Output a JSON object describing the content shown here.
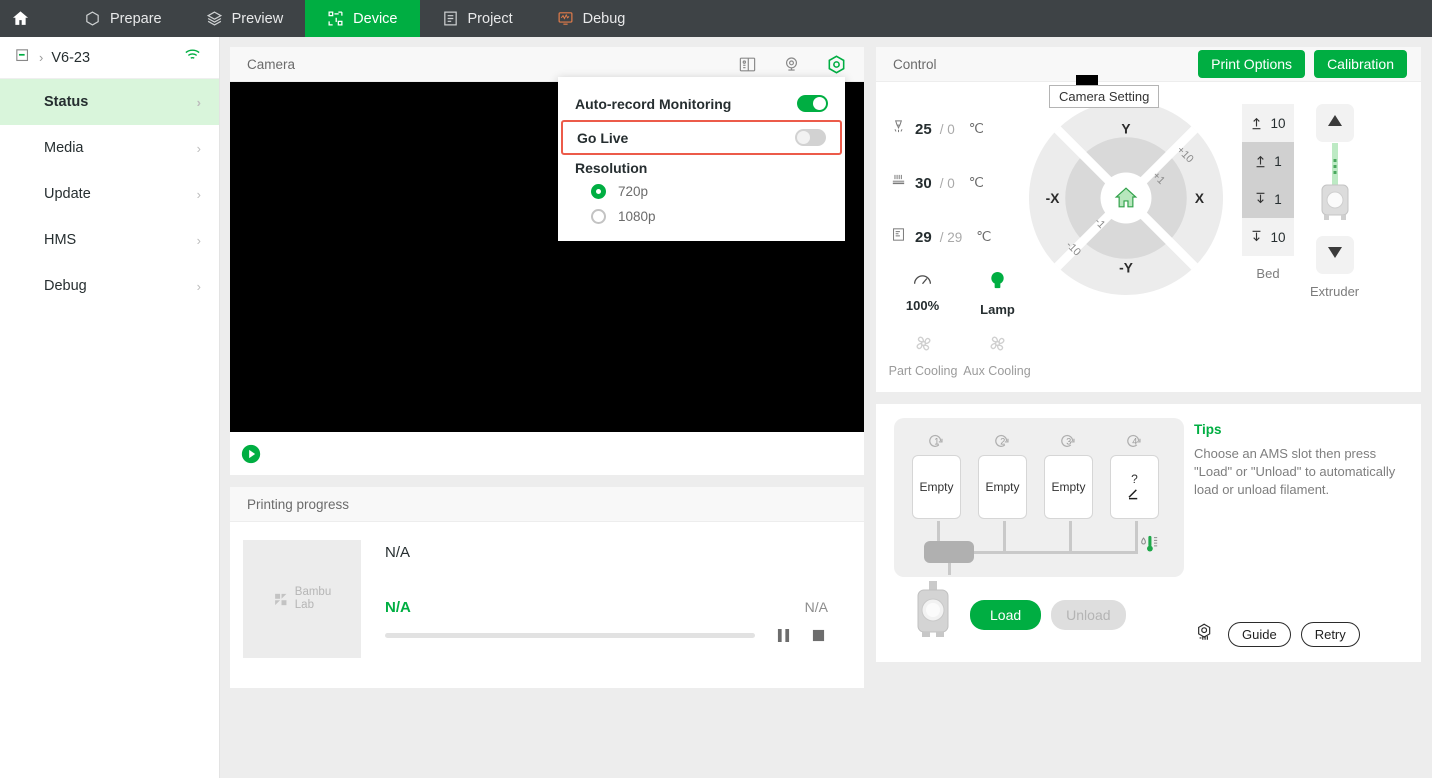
{
  "topnav": {
    "home_icon": "home-icon",
    "items": [
      {
        "label": "Prepare",
        "icon": "cube-outline-icon",
        "active": false
      },
      {
        "label": "Preview",
        "icon": "layers-icon",
        "active": false
      },
      {
        "label": "Device",
        "icon": "device-network-icon",
        "active": true
      },
      {
        "label": "Project",
        "icon": "list-document-icon",
        "active": false
      },
      {
        "label": "Debug",
        "icon": "monitor-wave-icon",
        "active": false
      }
    ],
    "active_color": "#00ae42",
    "bar_color": "#3e4346"
  },
  "sidebar": {
    "printer": {
      "name": "V6-23",
      "device_icon": "printer-icon",
      "separator": "›",
      "wifi_icon": "wifi-icon"
    },
    "items": [
      {
        "label": "Status",
        "active": true,
        "arrow": "›"
      },
      {
        "label": "Media",
        "active": false,
        "arrow": "›"
      },
      {
        "label": "Update",
        "active": false,
        "arrow": "›"
      },
      {
        "label": "HMS",
        "active": false,
        "arrow": "›"
      },
      {
        "label": "Debug",
        "active": false,
        "arrow": "›"
      }
    ],
    "active_bg": "#d9f5db"
  },
  "camera": {
    "title": "Camera",
    "icons": [
      {
        "name": "sdcard-icon"
      },
      {
        "name": "webcam-icon"
      },
      {
        "name": "camera-setting-gear-icon",
        "active": true
      }
    ],
    "play_button": "play-icon",
    "tooltip": "Camera Setting",
    "menu": {
      "auto_record_label": "Auto-record Monitoring",
      "auto_record_on": true,
      "go_live_label": "Go Live",
      "go_live_on": false,
      "resolution_label": "Resolution",
      "resolution_options": [
        {
          "label": "720p",
          "selected": true
        },
        {
          "label": "1080p",
          "selected": false
        }
      ],
      "highlight_color": "#ec5b4a"
    }
  },
  "printing_progress": {
    "title": "Printing progress",
    "thumbnail_brand_line1": "Bambu",
    "thumbnail_brand_line2": "Lab",
    "task_name": "N/A",
    "percent_text": "N/A",
    "time_text": "N/A",
    "progress_value": 0,
    "pause_button": "pause-icon",
    "stop_button": "stop-icon"
  },
  "control": {
    "title": "Control",
    "print_options_label": "Print Options",
    "calibration_label": "Calibration",
    "temperatures": [
      {
        "icon": "nozzle-icon",
        "current": "25",
        "target": "0",
        "unit": "℃"
      },
      {
        "icon": "bed-heat-icon",
        "current": "30",
        "target": "0",
        "unit": "℃"
      },
      {
        "icon": "chamber-icon",
        "current": "29",
        "target": "29",
        "unit": "℃"
      }
    ],
    "speed": {
      "icon": "speed-gauge-icon",
      "label": "100%"
    },
    "lamp": {
      "icon": "lamp-icon",
      "label": "Lamp",
      "on": true,
      "color": "#00ae42"
    },
    "fans": [
      {
        "icon": "fan-icon",
        "label": "Part Cooling",
        "on": false
      },
      {
        "icon": "fan-icon",
        "label": "Aux Cooling",
        "on": false
      }
    ],
    "axis_wheel": {
      "up": "Y",
      "down": "-Y",
      "left": "-X",
      "right": "X",
      "outer_step": "+10",
      "inner_step": "+1",
      "outer_step_neg": "-10",
      "inner_step_neg": "-1",
      "home_icon": "home-axis-icon"
    },
    "bed": {
      "caption": "Bed",
      "buttons": [
        {
          "icon": "arrow-up-bar-icon",
          "value": "10",
          "shade": "lite"
        },
        {
          "icon": "arrow-up-bar-icon",
          "value": "1",
          "shade": "dark"
        },
        {
          "icon": "arrow-down-bar-icon",
          "value": "1",
          "shade": "dark"
        },
        {
          "icon": "arrow-down-bar-icon",
          "value": "10",
          "shade": "lite"
        }
      ]
    },
    "extruder": {
      "caption": "Extruder",
      "up_icon": "triangle-up-icon",
      "down_icon": "triangle-down-icon",
      "graphic": "extruder-icon"
    }
  },
  "ams": {
    "slots": [
      {
        "number": "1",
        "label": "Empty",
        "icon": ""
      },
      {
        "number": "2",
        "label": "Empty",
        "icon": ""
      },
      {
        "number": "3",
        "label": "Empty",
        "icon": ""
      },
      {
        "number": "4",
        "label": "?",
        "icon": "edit-pencil-icon"
      }
    ],
    "humidity_icon": "humidity-thermometer-icon",
    "spool_icon": "spool-holder-icon",
    "load_label": "Load",
    "unload_label": "Unload",
    "unload_disabled": true
  },
  "tips": {
    "title": "Tips",
    "text": "Choose an AMS slot then press \"Load\" or \"Unload\" to automatically load or unload filament.",
    "filament_icon": "filament-sensor-icon",
    "guide_label": "Guide",
    "retry_label": "Retry"
  }
}
